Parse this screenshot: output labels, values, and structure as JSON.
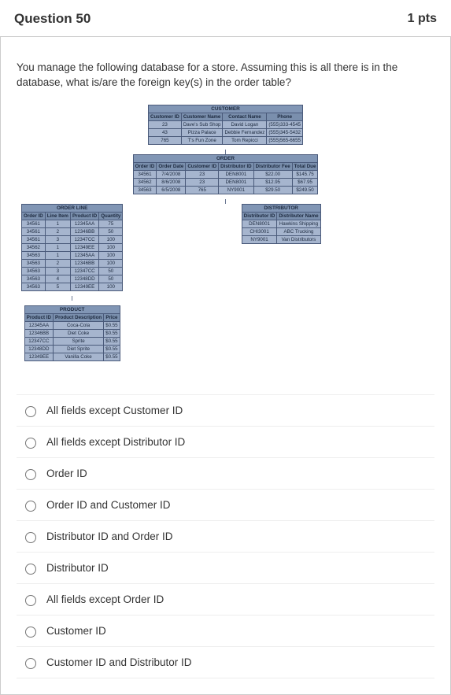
{
  "question": {
    "number": "Question 50",
    "points": "1 pts",
    "text": "You manage the following database for a store. Assuming this is all there is in the database, what is/are the foreign key(s) in the order table?"
  },
  "tables": {
    "customer": {
      "title": "CUSTOMER",
      "headers": [
        "Customer ID",
        "Customer Name",
        "Contact Name",
        "Phone"
      ],
      "rows": [
        [
          "23",
          "Dave's Sub Shop",
          "David Logan",
          "(555)333-4545"
        ],
        [
          "43",
          "Pizza Palace",
          "Debbie Fernandez",
          "(555)345-5432"
        ],
        [
          "765",
          "T's Fun Zone",
          "Tom Repicci",
          "(555)565-6655"
        ]
      ]
    },
    "order": {
      "title": "ORDER",
      "headers": [
        "Order ID",
        "Order Date",
        "Customer ID",
        "Distributor ID",
        "Distributor Fee",
        "Total Due"
      ],
      "rows": [
        [
          "34561",
          "7/4/2008",
          "23",
          "DEN8001",
          "$22.00",
          "$145.75"
        ],
        [
          "34562",
          "8/6/2008",
          "23",
          "DEN8001",
          "$12.95",
          "$67.95"
        ],
        [
          "34563",
          "6/5/2008",
          "765",
          "NY9001",
          "$29.50",
          "$249.50"
        ]
      ]
    },
    "orderline": {
      "title": "ORDER LINE",
      "headers": [
        "Order ID",
        "Line Item",
        "Product ID",
        "Quantity"
      ],
      "rows": [
        [
          "34561",
          "1",
          "12345AA",
          "75"
        ],
        [
          "34561",
          "2",
          "12346BB",
          "50"
        ],
        [
          "34561",
          "3",
          "12347CC",
          "100"
        ],
        [
          "34562",
          "1",
          "12349EE",
          "100"
        ],
        [
          "34563",
          "1",
          "12345AA",
          "100"
        ],
        [
          "34563",
          "2",
          "12346BB",
          "100"
        ],
        [
          "34563",
          "3",
          "12347CC",
          "50"
        ],
        [
          "34563",
          "4",
          "12348DD",
          "50"
        ],
        [
          "34563",
          "5",
          "12349EE",
          "100"
        ]
      ]
    },
    "distributor": {
      "title": "DISTRIBUTOR",
      "headers": [
        "Distributor ID",
        "Distributor Name"
      ],
      "rows": [
        [
          "DEN8001",
          "Hawkins Shipping"
        ],
        [
          "CHI3001",
          "ABC Trucking"
        ],
        [
          "NY9001",
          "Van Distributors"
        ]
      ]
    },
    "product": {
      "title": "PRODUCT",
      "headers": [
        "Product ID",
        "Product Description",
        "Price"
      ],
      "rows": [
        [
          "12345AA",
          "Coca-Cola",
          "$0.55"
        ],
        [
          "12346BB",
          "Diet Coke",
          "$0.55"
        ],
        [
          "12347CC",
          "Sprite",
          "$0.55"
        ],
        [
          "12348DD",
          "Diet Sprite",
          "$0.55"
        ],
        [
          "12349EE",
          "Vanilla Coke",
          "$0.55"
        ]
      ]
    }
  },
  "options": [
    "All fields except Customer ID",
    "All fields except Distributor ID",
    "Order ID",
    "Order ID and Customer ID",
    "Distributor ID and Order ID",
    "Distributor ID",
    "All fields except Order ID",
    "Customer ID",
    "Customer ID and Distributor ID"
  ]
}
